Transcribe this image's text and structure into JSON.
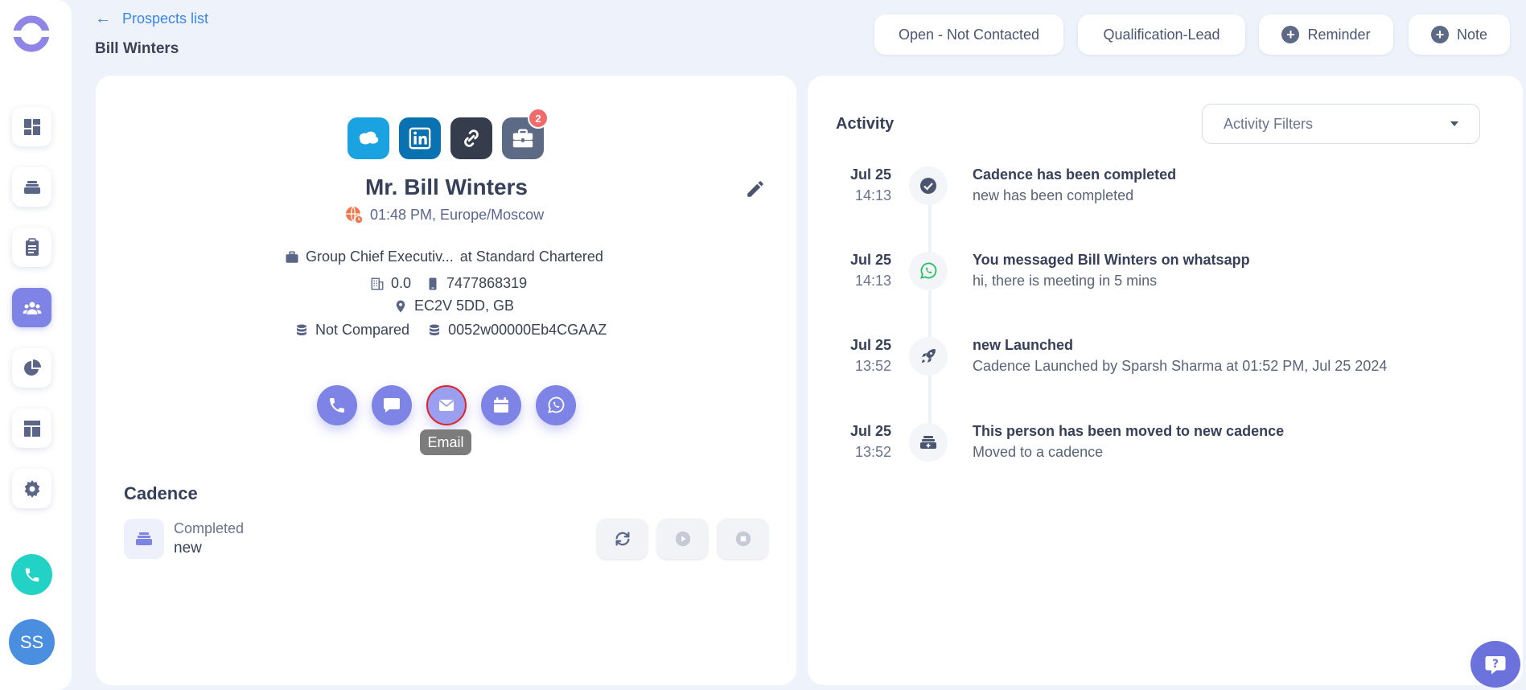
{
  "header": {
    "back_label": "Prospects list",
    "prospect_name": "Bill Winters",
    "status_button": "Open - Not Contacted",
    "stage_button": "Qualification-Lead",
    "reminder_button": "Reminder",
    "note_button": "Note"
  },
  "sidebar": {
    "avatar_initials": "SS",
    "items": [
      "dashboard-icon",
      "stack-icon",
      "clipboard-icon",
      "people-icon",
      "pie-chart-icon",
      "layout-icon",
      "gear-icon"
    ],
    "active_item": "people-icon"
  },
  "profile": {
    "socials": [
      "salesforce-icon",
      "linkedin-icon",
      "link-icon",
      "briefcase-icon"
    ],
    "briefcase_badge": "2",
    "full_name": "Mr. Bill Winters",
    "timezone": "01:48 PM, Europe/Moscow",
    "job_title": "Group Chief Executiv...",
    "company_connector": "at Standard Chartered",
    "company_size": "0.0",
    "phone": "7477868319",
    "location": "EC2V 5DD, GB",
    "compare_status": "Not Compared",
    "crm_id": "0052w00000Eb4CGAAZ"
  },
  "actions": {
    "items": [
      "call",
      "message",
      "email",
      "calendar",
      "whatsapp"
    ],
    "tooltip": "Email"
  },
  "cadence": {
    "title": "Cadence",
    "status": "Completed",
    "name": "new"
  },
  "activity": {
    "title": "Activity",
    "filter_label": "Activity Filters",
    "events": [
      {
        "date": "Jul 25",
        "time": "14:13",
        "icon": "check-circle-icon",
        "title": "Cadence has been completed",
        "desc": "new has been completed"
      },
      {
        "date": "Jul 25",
        "time": "14:13",
        "icon": "whatsapp-icon",
        "title": "You messaged Bill Winters on whatsapp",
        "desc": "hi, there is meeting in 5 mins"
      },
      {
        "date": "Jul 25",
        "time": "13:52",
        "icon": "rocket-icon",
        "title": "new Launched",
        "desc": "Cadence Launched by Sparsh Sharma at 01:52 PM, Jul 25 2024"
      },
      {
        "date": "Jul 25",
        "time": "13:52",
        "icon": "stack-plus-icon",
        "title": "This person has been moved to new cadence",
        "desc": "Moved to a cadence"
      }
    ]
  },
  "colors": {
    "accent": "#7e83e6",
    "link": "#3a86e8",
    "teal": "#22d3c5",
    "badge": "#f06b6b"
  }
}
